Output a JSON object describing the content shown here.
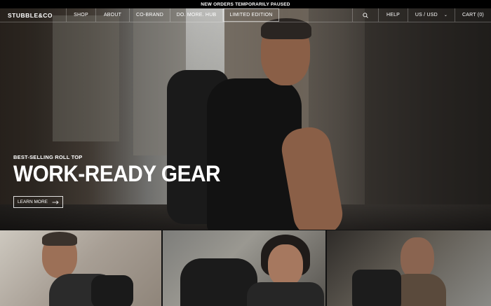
{
  "announcement": "NEW ORDERS TEMPORARILY PAUSED",
  "nav": {
    "logo": "STUBBLE&CO",
    "items": [
      "SHOP",
      "ABOUT",
      "CO-BRAND",
      "DO. MORE. HUB",
      "LIMITED EDITION"
    ],
    "help": "HELP",
    "currency": "US / USD",
    "cart": "CART (0)"
  },
  "hero": {
    "eyebrow": "BEST-SELLING ROLL TOP",
    "headline": "WORK-READY GEAR",
    "cta": "LEARN MORE"
  },
  "icons": {
    "search": "search-icon",
    "chevron": "chevron-down-icon",
    "arrow": "arrow-right-icon"
  }
}
